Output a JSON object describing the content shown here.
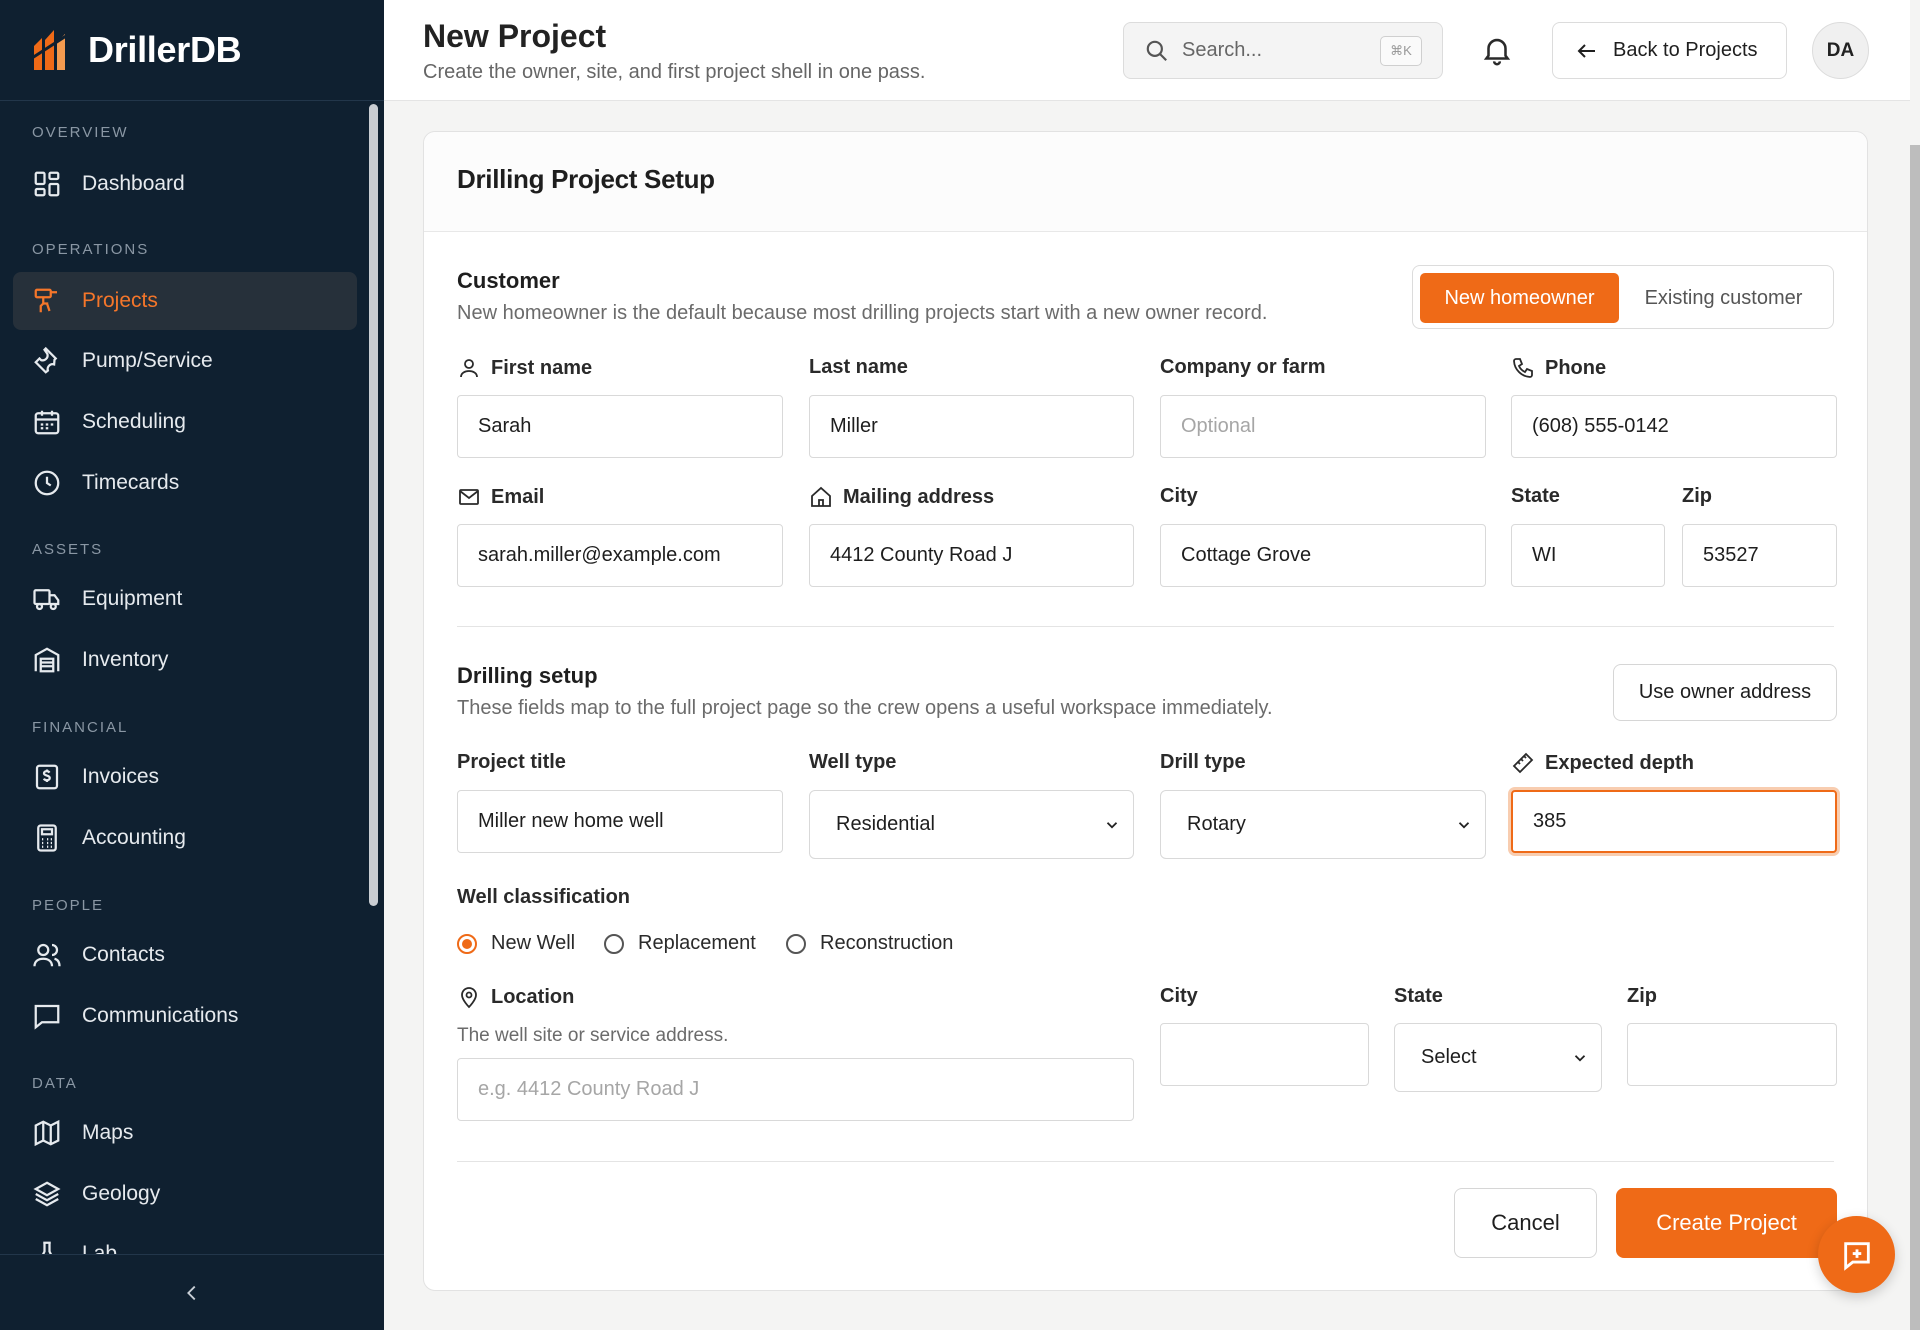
{
  "brand": {
    "name": "DrillerDB"
  },
  "sidebar": {
    "sections": [
      "OVERVIEW",
      "OPERATIONS",
      "ASSETS",
      "FINANCIAL",
      "PEOPLE",
      "DATA"
    ],
    "items": [
      {
        "label": "Dashboard",
        "icon": "dashboard-icon"
      },
      {
        "label": "Projects",
        "icon": "drill-icon",
        "active": true
      },
      {
        "label": "Pump/Service",
        "icon": "wrench-icon"
      },
      {
        "label": "Scheduling",
        "icon": "calendar-icon"
      },
      {
        "label": "Timecards",
        "icon": "clock-icon"
      },
      {
        "label": "Equipment",
        "icon": "truck-icon"
      },
      {
        "label": "Inventory",
        "icon": "warehouse-icon"
      },
      {
        "label": "Invoices",
        "icon": "invoice-icon"
      },
      {
        "label": "Accounting",
        "icon": "calculator-icon"
      },
      {
        "label": "Contacts",
        "icon": "users-icon"
      },
      {
        "label": "Communications",
        "icon": "message-icon"
      },
      {
        "label": "Maps",
        "icon": "map-icon"
      },
      {
        "label": "Geology",
        "icon": "layers-icon"
      },
      {
        "label": "Lab",
        "icon": "flask-icon"
      }
    ]
  },
  "header": {
    "title": "New Project",
    "subtitle": "Create the owner, site, and first project shell in one pass.",
    "search_placeholder": "Search...",
    "search_shortcut": "⌘K",
    "back_label": "Back to Projects",
    "avatar_initials": "DA"
  },
  "card": {
    "title": "Drilling Project Setup"
  },
  "customer": {
    "title": "Customer",
    "description": "New homeowner is the default because most drilling projects start with a new owner record.",
    "toggle": {
      "new": "New homeowner",
      "existing": "Existing customer"
    },
    "fields": {
      "first_name": {
        "label": "First name",
        "value": "Sarah"
      },
      "last_name": {
        "label": "Last name",
        "value": "Miller"
      },
      "company": {
        "label": "Company or farm",
        "placeholder": "Optional"
      },
      "phone": {
        "label": "Phone",
        "value": "(608) 555-0142"
      },
      "email": {
        "label": "Email",
        "value": "sarah.miller@example.com"
      },
      "mailing_address": {
        "label": "Mailing address",
        "value": "4412 County Road J"
      },
      "city": {
        "label": "City",
        "value": "Cottage Grove"
      },
      "state": {
        "label": "State",
        "value": "WI"
      },
      "zip": {
        "label": "Zip",
        "value": "53527"
      }
    }
  },
  "drilling": {
    "title": "Drilling setup",
    "description": "These fields map to the full project page so the crew opens a useful workspace immediately.",
    "use_owner_address": "Use owner address",
    "project_title": {
      "label": "Project title",
      "value": "Miller new home well"
    },
    "well_type": {
      "label": "Well type",
      "value": "Residential"
    },
    "drill_type": {
      "label": "Drill type",
      "value": "Rotary"
    },
    "expected_depth": {
      "label": "Expected depth",
      "value": "385"
    },
    "classification": {
      "label": "Well classification",
      "options": [
        "New Well",
        "Replacement",
        "Reconstruction"
      ],
      "selected": "New Well"
    },
    "location": {
      "label": "Location",
      "hint": "The well site or service address.",
      "placeholder": "e.g. 4412 County Road J"
    },
    "city": {
      "label": "City",
      "value": ""
    },
    "state": {
      "label": "State",
      "value": "Select"
    },
    "zip": {
      "label": "Zip",
      "value": ""
    }
  },
  "actions": {
    "cancel": "Cancel",
    "create": "Create Project"
  },
  "colors": {
    "accent": "#ef6a17",
    "sidebar_bg": "#0f2030"
  }
}
